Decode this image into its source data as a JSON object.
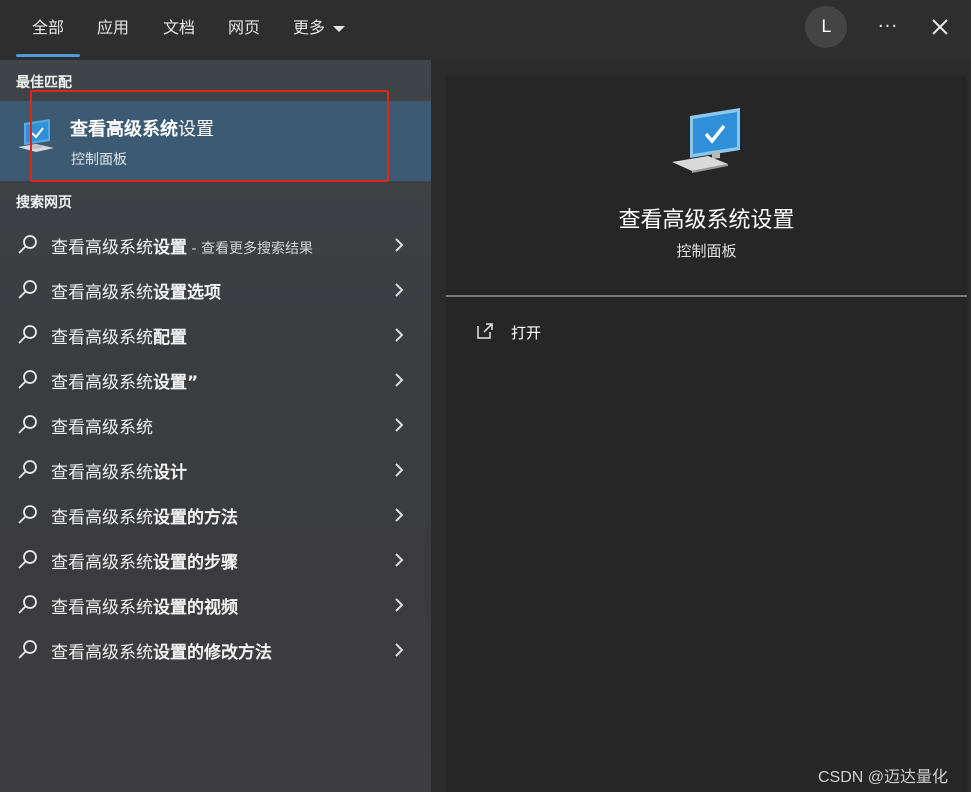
{
  "tabs": [
    {
      "label": "全部",
      "active": true
    },
    {
      "label": "应用",
      "active": false
    },
    {
      "label": "文档",
      "active": false
    },
    {
      "label": "网页",
      "active": false
    },
    {
      "label": "更多",
      "active": false
    }
  ],
  "header": {
    "avatar_letter": "L",
    "more_label": "···",
    "accent_color": "#4f9bd9"
  },
  "best_match": {
    "section_label": "最佳匹配",
    "title_bold": "查看高级系统",
    "title_rest": "设置",
    "subtitle": "控制面板",
    "highlight_color": "#3c5a72",
    "annotation_color": "#e0251c"
  },
  "web": {
    "section_label": "搜索网页",
    "items": [
      {
        "plain": "查看高级系统",
        "bold": "设置",
        "hint": " - 查看更多搜索结果"
      },
      {
        "plain": "查看高级系统",
        "bold": "设置选项",
        "hint": ""
      },
      {
        "plain": "查看高级系统",
        "bold": "配置",
        "hint": ""
      },
      {
        "plain": "查看高级系统",
        "bold": "设置”",
        "hint": ""
      },
      {
        "plain": "查看高级系统",
        "bold": "",
        "hint": ""
      },
      {
        "plain": "查看高级系统",
        "bold": "设计",
        "hint": ""
      },
      {
        "plain": "查看高级系统",
        "bold": "设置的方法",
        "hint": ""
      },
      {
        "plain": "查看高级系统",
        "bold": "设置的步骤",
        "hint": ""
      },
      {
        "plain": "查看高级系统",
        "bold": "设置的视频",
        "hint": ""
      },
      {
        "plain": "查看高级系统",
        "bold": "设置的修改方法",
        "hint": ""
      }
    ]
  },
  "detail": {
    "title": "查看高级系统设置",
    "subtitle": "控制面板",
    "actions": [
      {
        "label": "打开",
        "icon": "open-external-icon"
      }
    ]
  },
  "watermark": "CSDN @迈达量化"
}
